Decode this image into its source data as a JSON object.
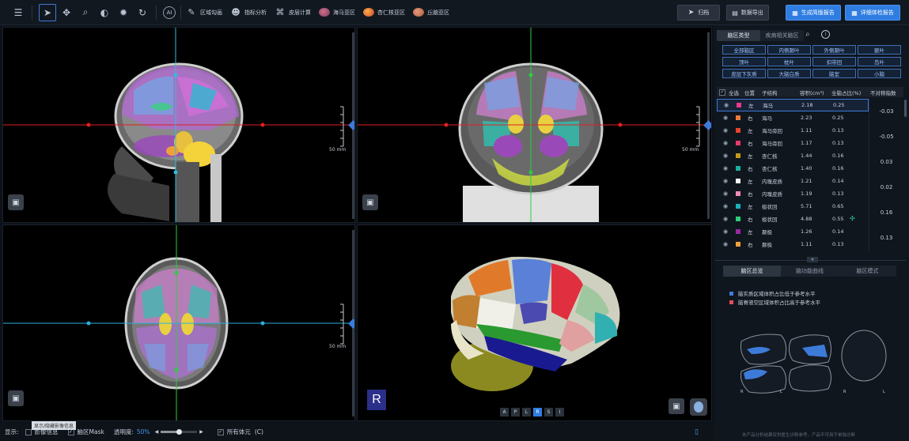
{
  "toolbar": {
    "tools": [
      {
        "label": "区域勾画",
        "icon": "pencil-icon"
      },
      {
        "label": "指标分析",
        "icon": "head-analysis-icon"
      },
      {
        "label": "皮层计算",
        "icon": "cortex-calc-icon"
      },
      {
        "label": "海马亚区",
        "icon": "hippocampus-icon"
      },
      {
        "label": "杏仁核亚区",
        "icon": "amygdala-icon"
      },
      {
        "label": "丘脑亚区",
        "icon": "thalamus-icon"
      }
    ],
    "archive_label": "归档",
    "export_label": "数据导出",
    "report_label": "生成简版报告",
    "detail_report_label": "详细体检报告"
  },
  "viewports": {
    "scale_label": "50 mm",
    "orientation": [
      "A",
      "P",
      "L",
      "R",
      "S",
      "I"
    ],
    "orientation_active": "R",
    "marker_label": "R"
  },
  "panel": {
    "tabs": [
      "脑区类型",
      "疾病相关脑区"
    ],
    "region_buttons": [
      "全部脑区",
      "内侧颞叶",
      "外侧颞叶",
      "额叶",
      "顶叶",
      "枕叶",
      "扣带回",
      "岛叶",
      "皮层下灰质",
      "大脑白质",
      "脑室",
      "小脑"
    ],
    "table_headers": {
      "select_all": "全选",
      "side": "位置",
      "structure": "子结构",
      "volume": "容积(cm³)",
      "ratio": "全脑占比(%)",
      "asym": "不对称指数"
    },
    "rows": [
      {
        "side": "左",
        "name": "海马",
        "vol": "2.18",
        "ratio": "0.25",
        "color": "#e83a8a"
      },
      {
        "side": "右",
        "name": "海马",
        "vol": "2.23",
        "ratio": "0.25",
        "color": "#f07a3a"
      },
      {
        "side": "左",
        "name": "海马旁回",
        "vol": "1.11",
        "ratio": "0.13",
        "color": "#e8432a"
      },
      {
        "side": "右",
        "name": "海马旁回",
        "vol": "1.17",
        "ratio": "0.13",
        "color": "#e83a6a"
      },
      {
        "side": "左",
        "name": "杏仁核",
        "vol": "1.44",
        "ratio": "0.16",
        "color": "#c79a1a"
      },
      {
        "side": "右",
        "name": "杏仁核",
        "vol": "1.40",
        "ratio": "0.16",
        "color": "#1ab0a0"
      },
      {
        "side": "左",
        "name": "内嗅皮质",
        "vol": "1.21",
        "ratio": "0.14",
        "color": "#f4f4f4"
      },
      {
        "side": "右",
        "name": "内嗅皮质",
        "vol": "1.19",
        "ratio": "0.13",
        "color": "#f08ab8"
      },
      {
        "side": "左",
        "name": "梭状回",
        "vol": "5.71",
        "ratio": "0.65",
        "color": "#1ab0c0"
      },
      {
        "side": "右",
        "name": "梭状回",
        "vol": "4.88",
        "ratio": "0.55",
        "color": "#2ad07a"
      },
      {
        "side": "左",
        "name": "颞极",
        "vol": "1.26",
        "ratio": "0.14",
        "color": "#9a2aa0"
      },
      {
        "side": "右",
        "name": "颞极",
        "vol": "1.11",
        "ratio": "0.13",
        "color": "#f0a03a"
      }
    ],
    "asym_values": [
      "-0.03",
      "-0.05",
      "0.03",
      "0.02",
      "0.16",
      "0.13"
    ],
    "bottom_tabs": [
      "脑区总览",
      "脑功能曲线",
      "脑区模式"
    ],
    "legend": [
      {
        "text": "脑实质区域体积占比低于参考水平",
        "color": "#3d7bd9"
      },
      {
        "text": "脑脊液空区域体积占比高于参考水平",
        "color": "#e0505a"
      }
    ],
    "brain_view_labels": [
      "R",
      "L",
      "R",
      "L"
    ],
    "disclaimer": "本产品分析结果仅供医生诊断参考，产品不可用于单独诊断"
  },
  "bottombar": {
    "show_label": "显示:",
    "tooltip": "显示/隐藏影像信息",
    "options": [
      {
        "label": "影像信息",
        "checked": false
      },
      {
        "label": "脑区Mask",
        "checked": true
      }
    ],
    "opacity_label": "透明度:",
    "opacity_value": "50%",
    "opacity_fraction": 0.5,
    "all_voxels_label": "所有体元",
    "all_voxels_suffix": "(C)"
  }
}
